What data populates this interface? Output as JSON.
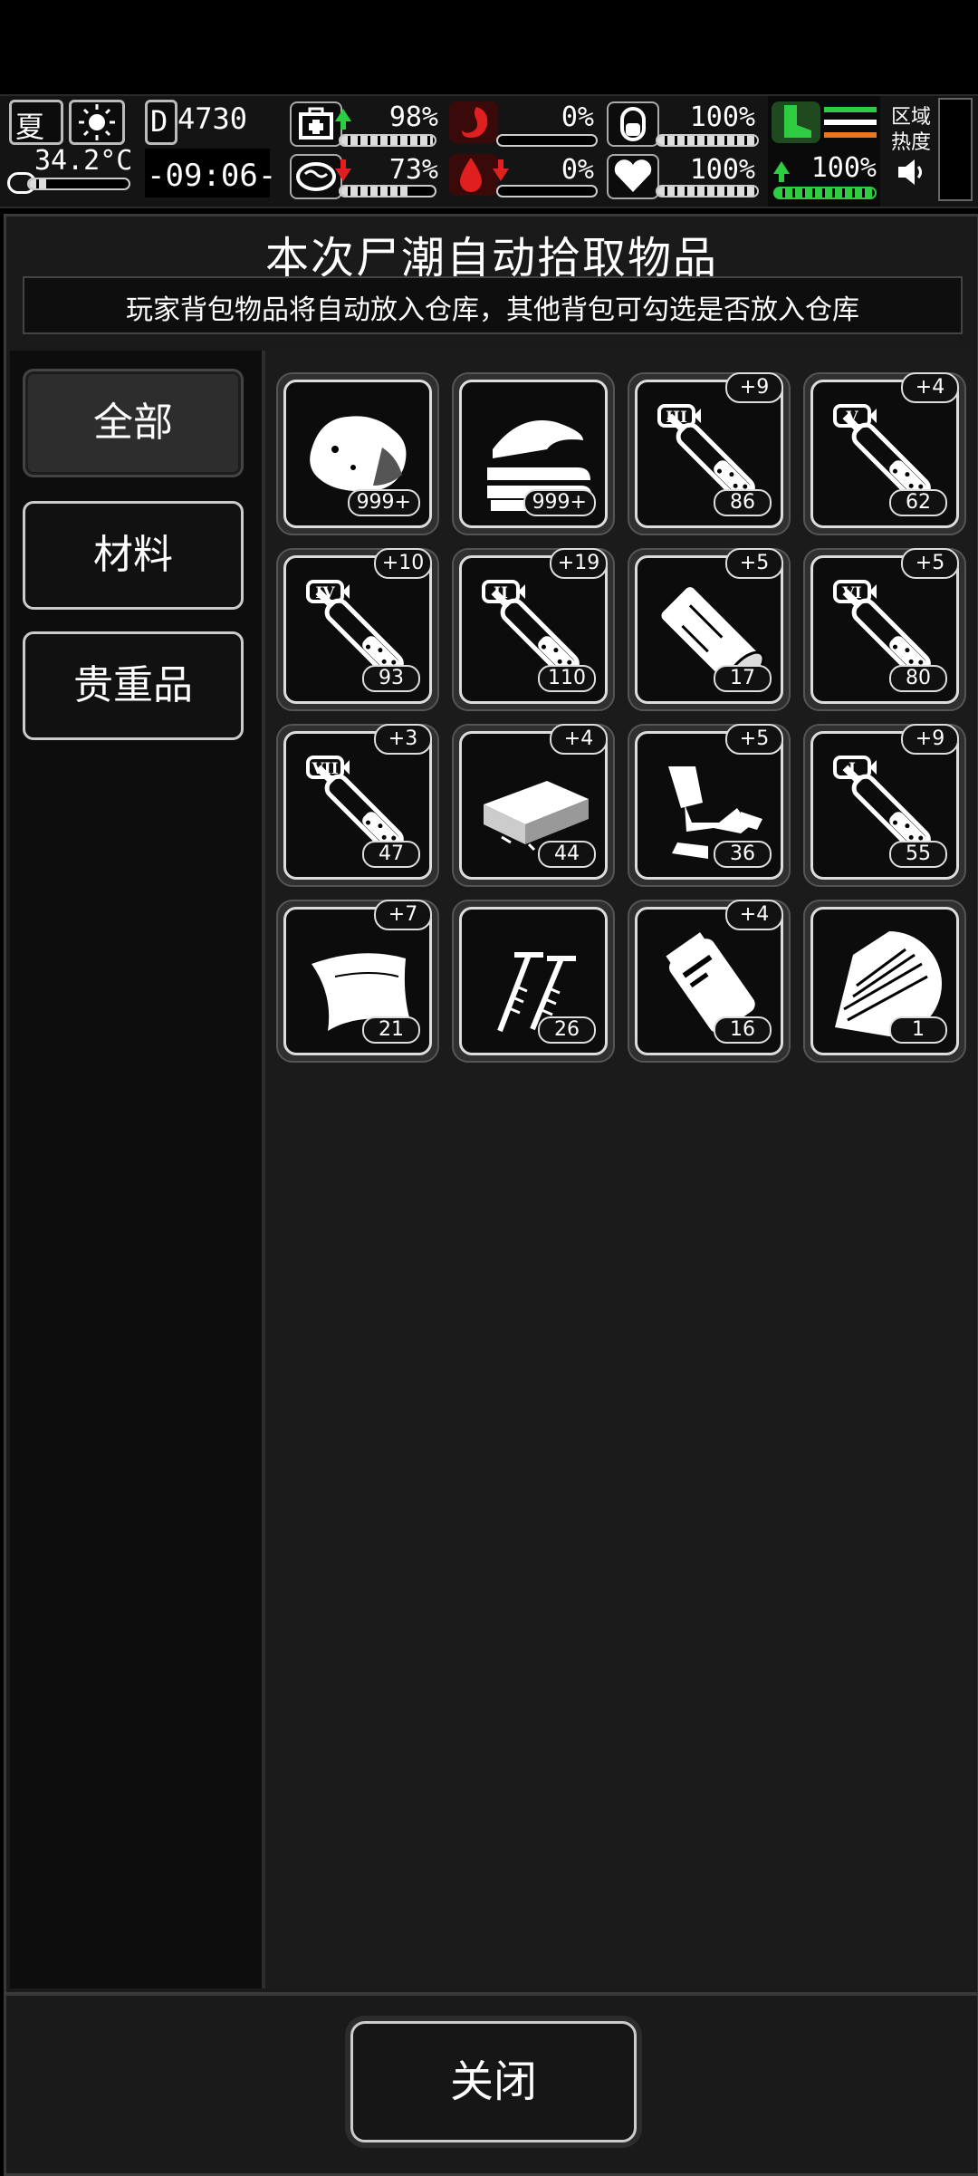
{
  "status": {
    "season": "夏",
    "temperature": "34.2°C",
    "day": "4730",
    "day_prefix": "D",
    "clock": "-09:06-",
    "health_pct": "98%",
    "hunger_pct": "0%",
    "stamina_pct": "100%",
    "brain_pct": "73%",
    "blood_pct": "0%",
    "heart_pct": "100%",
    "speed_pct": "100%",
    "zone_heat_label": "区域热度"
  },
  "panel": {
    "title": "本次尸潮自动拾取物品",
    "subtitle": "玩家背包物品将自动放入仓库，其他背包可勾选是否放入仓库"
  },
  "categories": [
    {
      "label": "全部",
      "active": true
    },
    {
      "label": "材料",
      "active": false
    },
    {
      "label": "贵重品",
      "active": false
    }
  ],
  "items": [
    {
      "icon": "meat-chunk-icon",
      "count": "999+",
      "bonus": ""
    },
    {
      "icon": "cloth-stack-icon",
      "count": "999+",
      "bonus": ""
    },
    {
      "icon": "syringe-III-icon",
      "count": "86",
      "bonus": "+9"
    },
    {
      "icon": "syringe-V-icon",
      "count": "62",
      "bonus": "+4"
    },
    {
      "icon": "syringe-IV-icon",
      "count": "93",
      "bonus": "+10"
    },
    {
      "icon": "syringe-II-icon",
      "count": "110",
      "bonus": "+19"
    },
    {
      "icon": "wood-log-icon",
      "count": "17",
      "bonus": "+5"
    },
    {
      "icon": "syringe-VI-icon",
      "count": "80",
      "bonus": "+5"
    },
    {
      "icon": "syringe-VII-icon",
      "count": "47",
      "bonus": "+3"
    },
    {
      "icon": "metal-plate-icon",
      "count": "44",
      "bonus": "+4"
    },
    {
      "icon": "scrap-parts-icon",
      "count": "36",
      "bonus": "+5"
    },
    {
      "icon": "syringe-I-icon",
      "count": "55",
      "bonus": "+9"
    },
    {
      "icon": "leather-sheet-icon",
      "count": "21",
      "bonus": "+7"
    },
    {
      "icon": "screws-icon",
      "count": "26",
      "bonus": ""
    },
    {
      "icon": "plastic-bag-icon",
      "count": "16",
      "bonus": "+4"
    },
    {
      "icon": "wood-scraps-icon",
      "count": "1",
      "bonus": ""
    }
  ],
  "syringe_labels": {
    "syringe-I-icon": "I",
    "syringe-II-icon": "II",
    "syringe-III-icon": "III",
    "syringe-IV-icon": "IV",
    "syringe-V-icon": "V",
    "syringe-VI-icon": "VI",
    "syringe-VII-icon": "VII"
  },
  "close_label": "关闭",
  "colors": {
    "green": "#2ecc40",
    "red": "#e02020",
    "orange": "#e87722"
  }
}
